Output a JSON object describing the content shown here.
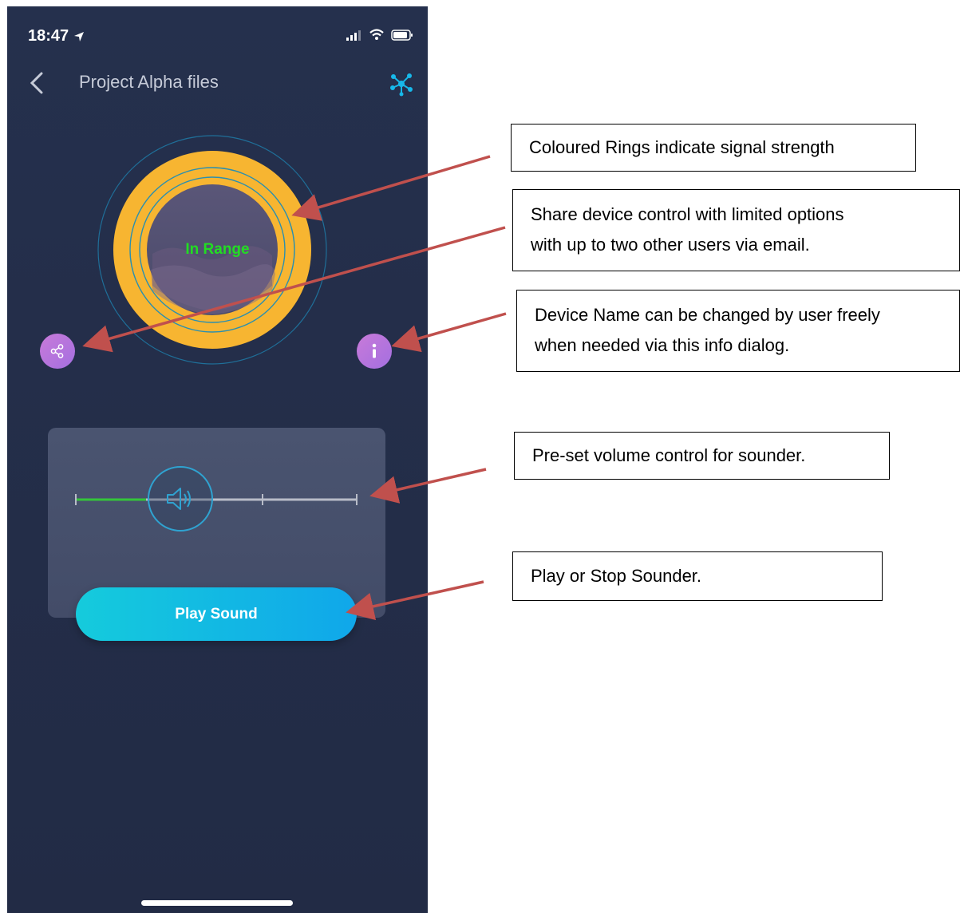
{
  "status_bar": {
    "time": "18:47"
  },
  "nav": {
    "title": "Project Alpha files"
  },
  "device": {
    "range_status": "In Range"
  },
  "volume": {
    "level_fraction": 0.25,
    "steps": 3
  },
  "play_button": {
    "label": "Play Sound"
  },
  "callouts": {
    "rings": "Coloured Rings indicate signal strength",
    "share_line1": "Share device control with limited options",
    "share_line2": "with up to two other users via email.",
    "info_line1": "Device Name can be changed by user freely",
    "info_line2": "when needed via this info dialog.",
    "volume": "Pre-set volume control for sounder.",
    "play": "Play or Stop Sounder."
  },
  "colors": {
    "background": "#232d48",
    "ring": "#f7b531",
    "accent": "#15cbdc",
    "status_text": "#22dd22",
    "arrow": "#c0504d",
    "action_button": "#b877de"
  },
  "icons": [
    "back-chevron-icon",
    "network-icon",
    "share-icon",
    "info-icon",
    "speaker-icon",
    "signal-icon",
    "wifi-icon",
    "battery-icon",
    "location-arrow-icon"
  ]
}
